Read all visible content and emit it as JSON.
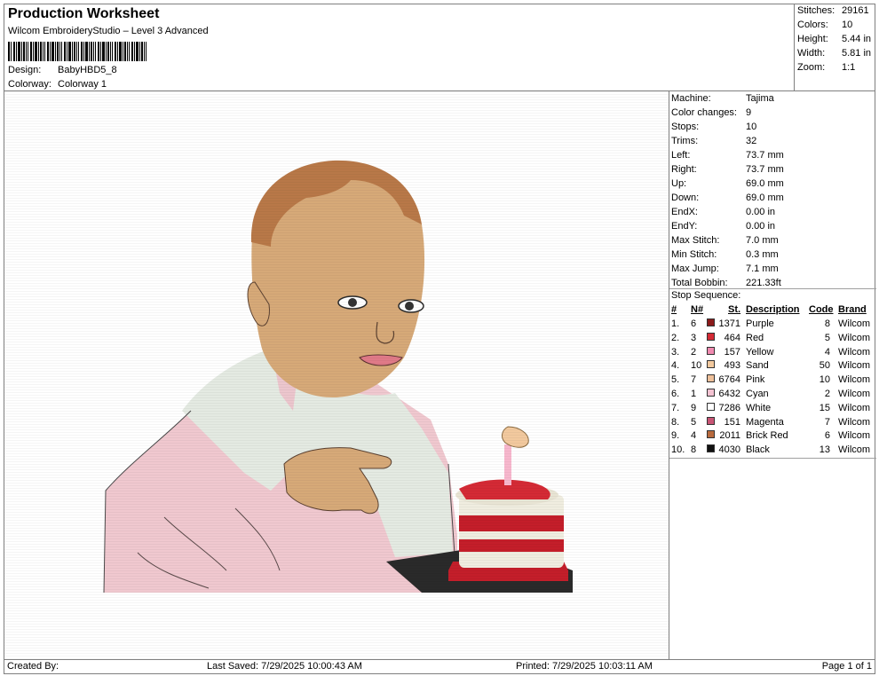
{
  "header": {
    "title": "Production Worksheet",
    "subtitle": "Wilcom EmbroideryStudio – Level 3 Advanced",
    "design_label": "Design:",
    "design_value": "BabyHBD5_8",
    "colorway_label": "Colorway:",
    "colorway_value": "Colorway 1"
  },
  "stats": [
    {
      "label": "Stitches:",
      "value": "29161"
    },
    {
      "label": "Colors:",
      "value": "10"
    },
    {
      "label": "Height:",
      "value": "5.44 in"
    },
    {
      "label": "Width:",
      "value": "5.81 in"
    },
    {
      "label": "Zoom:",
      "value": "1:1"
    }
  ],
  "machine_info": [
    {
      "label": "Machine:",
      "value": "Tajima"
    },
    {
      "label": "Color changes:",
      "value": "9"
    },
    {
      "label": "Stops:",
      "value": "10"
    },
    {
      "label": "Trims:",
      "value": "32"
    },
    {
      "label": "Left:",
      "value": "73.7 mm"
    },
    {
      "label": "Right:",
      "value": "73.7 mm"
    },
    {
      "label": "Up:",
      "value": "69.0 mm"
    },
    {
      "label": "Down:",
      "value": "69.0 mm"
    },
    {
      "label": "EndX:",
      "value": "0.00 in"
    },
    {
      "label": "EndY:",
      "value": "0.00 in"
    },
    {
      "label": "Max Stitch:",
      "value": "7.0 mm"
    },
    {
      "label": "Min Stitch:",
      "value": "0.3 mm"
    },
    {
      "label": "Max Jump:",
      "value": "7.1 mm"
    },
    {
      "label": "Total Bobbin:",
      "value": "221.33ft"
    }
  ],
  "stop_sequence": {
    "title": "Stop Sequence:",
    "headers": {
      "num": "#",
      "n": "N#",
      "st": "St.",
      "desc": "Description",
      "code": "Code",
      "brand": "Brand"
    },
    "rows": [
      {
        "num": "1.",
        "n": "6",
        "color": "#8b1a1a",
        "st": "1371",
        "desc": "Purple",
        "code": "8",
        "brand": "Wilcom"
      },
      {
        "num": "2.",
        "n": "3",
        "color": "#d42a35",
        "st": "464",
        "desc": "Red",
        "code": "5",
        "brand": "Wilcom"
      },
      {
        "num": "3.",
        "n": "2",
        "color": "#f08ab0",
        "st": "157",
        "desc": "Yellow",
        "code": "4",
        "brand": "Wilcom"
      },
      {
        "num": "4.",
        "n": "10",
        "color": "#f2c99e",
        "st": "493",
        "desc": "Sand",
        "code": "50",
        "brand": "Wilcom"
      },
      {
        "num": "5.",
        "n": "7",
        "color": "#eec09a",
        "st": "6764",
        "desc": "Pink",
        "code": "10",
        "brand": "Wilcom"
      },
      {
        "num": "6.",
        "n": "1",
        "color": "#f4c3d2",
        "st": "6432",
        "desc": "Cyan",
        "code": "2",
        "brand": "Wilcom"
      },
      {
        "num": "7.",
        "n": "9",
        "color": "#ffffff",
        "st": "7286",
        "desc": "White",
        "code": "15",
        "brand": "Wilcom"
      },
      {
        "num": "8.",
        "n": "5",
        "color": "#c85575",
        "st": "151",
        "desc": "Magenta",
        "code": "7",
        "brand": "Wilcom"
      },
      {
        "num": "9.",
        "n": "4",
        "color": "#b86a3e",
        "st": "2011",
        "desc": "Brick Red",
        "code": "6",
        "brand": "Wilcom"
      },
      {
        "num": "10.",
        "n": "8",
        "color": "#111111",
        "st": "4030",
        "desc": "Black",
        "code": "13",
        "brand": "Wilcom"
      }
    ]
  },
  "footer": {
    "created_by": "Created By:",
    "last_saved": "Last Saved: 7/29/2025 10:00:43 AM",
    "printed": "Printed: 7/29/2025 10:03:11 AM",
    "page": "Page 1 of 1"
  }
}
